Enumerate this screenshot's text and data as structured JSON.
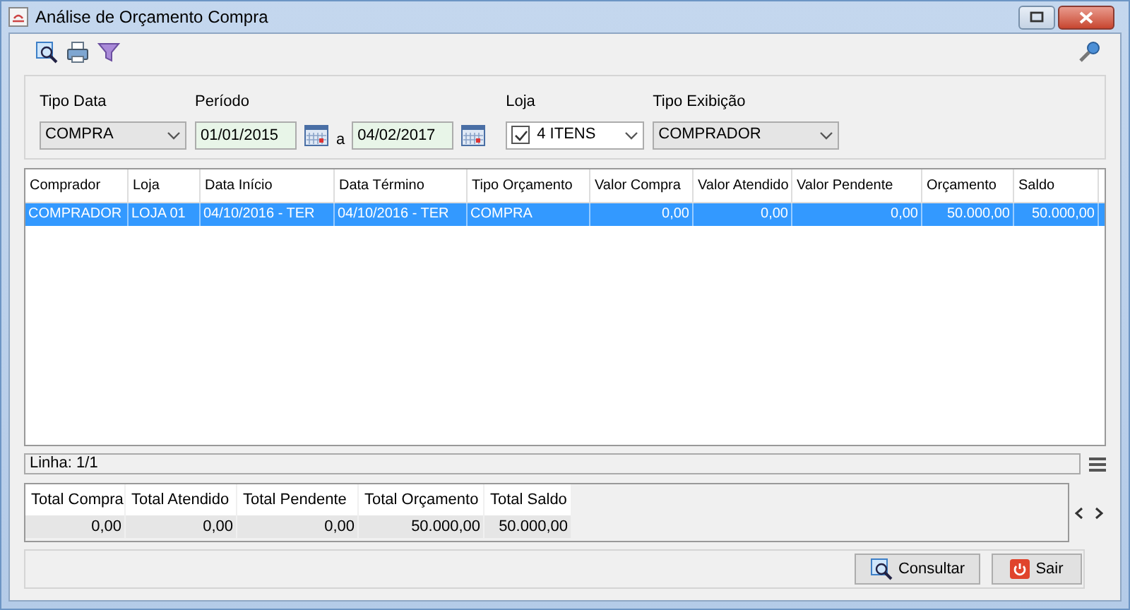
{
  "window": {
    "title": "Análise de Orçamento Compra"
  },
  "filters": {
    "tipo_data": {
      "label": "Tipo Data",
      "value": "COMPRA"
    },
    "periodo": {
      "label": "Período",
      "from": "01/01/2015",
      "separator": "a",
      "to": "04/02/2017"
    },
    "loja": {
      "label": "Loja",
      "checked": true,
      "value": "4 ITENS"
    },
    "tipo_exibicao": {
      "label": "Tipo Exibição",
      "value": "COMPRADOR"
    }
  },
  "table": {
    "columns": [
      {
        "label": "Comprador",
        "kind": "text"
      },
      {
        "label": "Loja",
        "kind": "text"
      },
      {
        "label": "Data Início",
        "kind": "text"
      },
      {
        "label": "Data Término",
        "kind": "text"
      },
      {
        "label": "Tipo Orçamento",
        "kind": "text"
      },
      {
        "label": "Valor Compra",
        "kind": "number"
      },
      {
        "label": "Valor Atendido",
        "kind": "number"
      },
      {
        "label": "Valor Pendente",
        "kind": "number"
      },
      {
        "label": "Orçamento",
        "kind": "number"
      },
      {
        "label": "Saldo",
        "kind": "number"
      }
    ],
    "rows": [
      {
        "selected": true,
        "cells": [
          "COMPRADOR",
          "LOJA 01",
          "04/10/2016 - TER",
          "04/10/2016 - TER",
          "COMPRA",
          "0,00",
          "0,00",
          "0,00",
          "50.000,00",
          "50.000,00"
        ]
      }
    ]
  },
  "status": "Linha: 1/1",
  "totals": [
    {
      "label": "Total Compra",
      "value": "0,00"
    },
    {
      "label": "Total Atendido",
      "value": "0,00"
    },
    {
      "label": "Total Pendente",
      "value": "0,00"
    },
    {
      "label": "Total Orçamento",
      "value": "50.000,00"
    },
    {
      "label": "Total Saldo",
      "value": "50.000,00"
    }
  ],
  "buttons": [
    {
      "kind": "search",
      "label": "Consultar"
    },
    {
      "kind": "exit",
      "label": "Sair"
    }
  ]
}
